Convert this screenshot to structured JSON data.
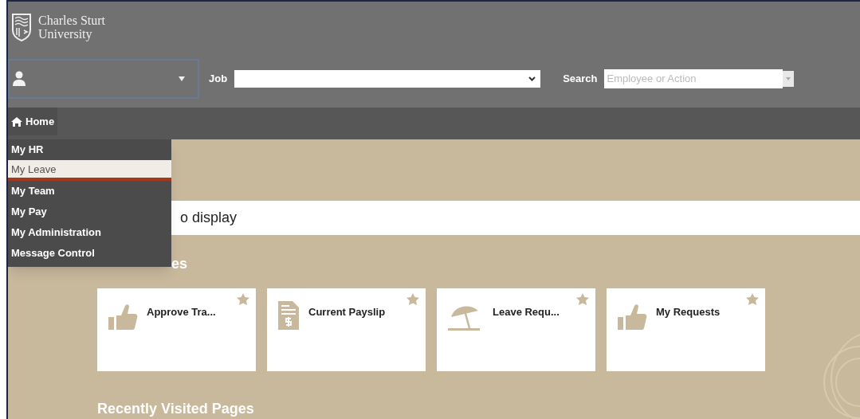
{
  "header": {
    "logo_line1": "Charles Sturt",
    "logo_line2": "University",
    "job_label": "Job",
    "search_label": "Search",
    "search": {
      "placeholder": "Employee or Action"
    }
  },
  "nav": {
    "home": "Home"
  },
  "menu": [
    {
      "label": "My HR",
      "selected": false
    },
    {
      "label": "My Leave",
      "selected": true
    },
    {
      "label": "My Team",
      "selected": false
    },
    {
      "label": "My Pay",
      "selected": false
    },
    {
      "label": "My Administration",
      "selected": false
    },
    {
      "label": "Message Control",
      "selected": false
    }
  ],
  "notice": "o display",
  "tiles_heading": "es",
  "tiles": [
    {
      "label": "Approve Tra...",
      "kind": "thumb"
    },
    {
      "label": "Current Payslip",
      "kind": "payslip"
    },
    {
      "label": "Leave Requ...",
      "kind": "umbrella"
    },
    {
      "label": "My Requests",
      "kind": "thumb"
    }
  ],
  "recent_heading": "Recently Visited Pages"
}
